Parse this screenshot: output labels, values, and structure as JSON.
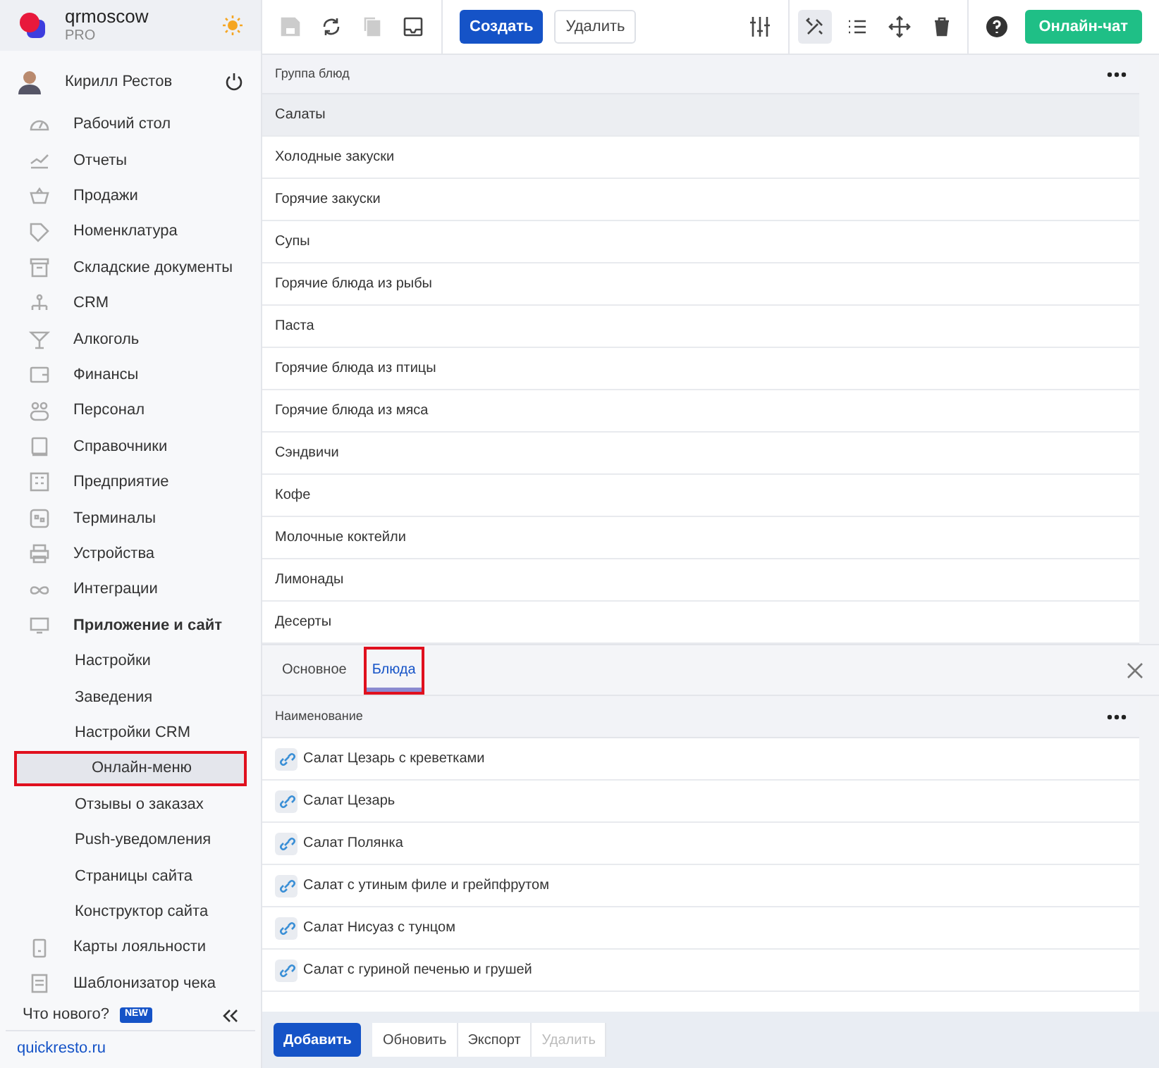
{
  "sidebar": {
    "org": {
      "name": "qrmoscow",
      "plan": "PRO"
    },
    "user": {
      "name": "Кирилл Рестов"
    },
    "items": [
      {
        "label": "Рабочий стол",
        "selected": false
      },
      {
        "label": "Отчеты",
        "selected": false
      },
      {
        "label": "Продажи",
        "selected": false
      },
      {
        "label": "Номенклатура",
        "selected": false
      },
      {
        "label": "Складские документы",
        "selected": false
      },
      {
        "label": "CRM",
        "selected": false
      },
      {
        "label": "Алкоголь",
        "selected": false
      },
      {
        "label": "Финансы",
        "selected": false
      },
      {
        "label": "Персонал",
        "selected": false
      },
      {
        "label": "Справочники",
        "selected": false
      },
      {
        "label": "Предприятие",
        "selected": false
      },
      {
        "label": "Терминалы",
        "selected": false
      },
      {
        "label": "Устройства",
        "selected": false
      },
      {
        "label": "Интеграции",
        "selected": false
      },
      {
        "label": "Приложение и сайт",
        "selected": false,
        "expanded": true,
        "children": [
          {
            "label": "Настройки",
            "selected": false
          },
          {
            "label": "Заведения",
            "selected": false
          },
          {
            "label": "Настройки CRM",
            "selected": false
          },
          {
            "label": "Онлайн-меню",
            "selected": true
          },
          {
            "label": "Отзывы о заказах",
            "selected": false
          },
          {
            "label": "Push-уведомления",
            "selected": false
          },
          {
            "label": "Страницы сайта",
            "selected": false
          },
          {
            "label": "Конструктор сайта",
            "selected": false
          }
        ]
      },
      {
        "label": "Карты лояльности",
        "selected": false
      },
      {
        "label": "Шаблонизатор чека",
        "selected": false
      }
    ],
    "whats_new": {
      "label": "Что нового?",
      "badge": "NEW"
    },
    "link": "quickresto.ru"
  },
  "toolbar": {
    "tools": [
      {
        "kind": "save",
        "disabled": true
      },
      {
        "kind": "refresh",
        "disabled": false
      },
      {
        "kind": "copy",
        "disabled": true
      },
      {
        "kind": "inbox",
        "disabled": false
      }
    ],
    "create": "Создать",
    "delete": "Удалить",
    "views": [
      {
        "kind": "tools",
        "selected": true
      },
      {
        "kind": "list",
        "selected": false
      },
      {
        "kind": "move",
        "selected": false
      },
      {
        "kind": "trash",
        "selected": false
      }
    ],
    "chat": "Онлайн-чат"
  },
  "groups": {
    "column": "Группа блюд",
    "rows": [
      {
        "label": "Салаты",
        "selected": true
      },
      {
        "label": "Холодные закуски",
        "selected": false
      },
      {
        "label": "Горячие закуски",
        "selected": false
      },
      {
        "label": "Супы",
        "selected": false
      },
      {
        "label": "Горячие блюда из рыбы",
        "selected": false
      },
      {
        "label": "Паста",
        "selected": false
      },
      {
        "label": "Горячие блюда из птицы",
        "selected": false
      },
      {
        "label": "Горячие блюда из мяса",
        "selected": false
      },
      {
        "label": "Сэндвичи",
        "selected": false
      },
      {
        "label": "Кофе",
        "selected": false
      },
      {
        "label": "Молочные коктейли",
        "selected": false
      },
      {
        "label": "Лимонады",
        "selected": false
      },
      {
        "label": "Десерты",
        "selected": false
      }
    ]
  },
  "detail": {
    "tabs": [
      {
        "label": "Основное",
        "selected": false
      },
      {
        "label": "Блюда",
        "selected": true
      }
    ],
    "column": "Наименование",
    "rows": [
      "Салат Цезарь с креветками",
      "Салат Цезарь",
      "Салат Полянка",
      "Салат с утиным филе и грейпфрутом",
      "Салат Нисуаз с тунцом",
      "Салат с гуриной печенью и грушей"
    ],
    "buttons": [
      {
        "label": "Добавить",
        "kind": "primary",
        "disabled": false
      },
      {
        "label": "Обновить",
        "kind": "plain",
        "disabled": false
      },
      {
        "label": "Экспорт",
        "kind": "plain",
        "disabled": false
      },
      {
        "label": "Удалить",
        "kind": "plain",
        "disabled": true
      }
    ]
  }
}
